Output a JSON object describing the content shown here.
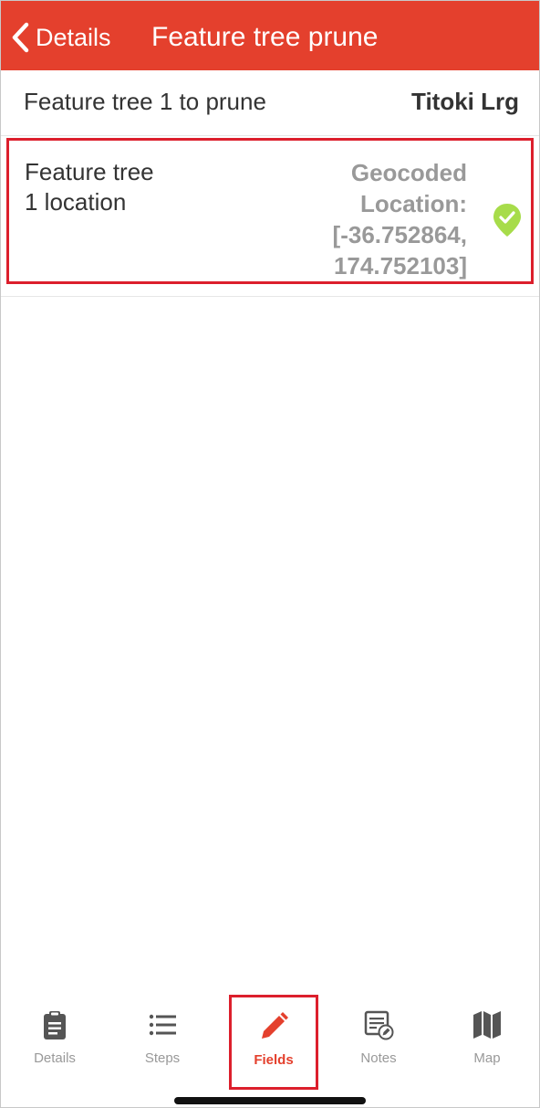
{
  "header": {
    "back_label": "Details",
    "title": "Feature tree prune",
    "background": "#e4402d"
  },
  "fields": [
    {
      "label": "Feature tree 1 to prune",
      "value": "Titoki Lrg"
    },
    {
      "label_line1": "Feature tree",
      "label_line2": "1 location",
      "value_line1": "Geocoded",
      "value_line2": "Location:",
      "value_line3": "[-36.752864,",
      "value_line4": "174.752103]",
      "status_icon": "check-circle-icon",
      "status_color": "#a7dc4a"
    }
  ],
  "tabs": [
    {
      "label": "Details",
      "icon": "clipboard-icon"
    },
    {
      "label": "Steps",
      "icon": "list-icon"
    },
    {
      "label": "Fields",
      "icon": "pencil-icon",
      "active": true
    },
    {
      "label": "Notes",
      "icon": "notes-icon"
    },
    {
      "label": "Map",
      "icon": "map-icon"
    }
  ],
  "colors": {
    "accent": "#e4402d",
    "highlight": "#dc1f2c",
    "muted": "#999999"
  }
}
